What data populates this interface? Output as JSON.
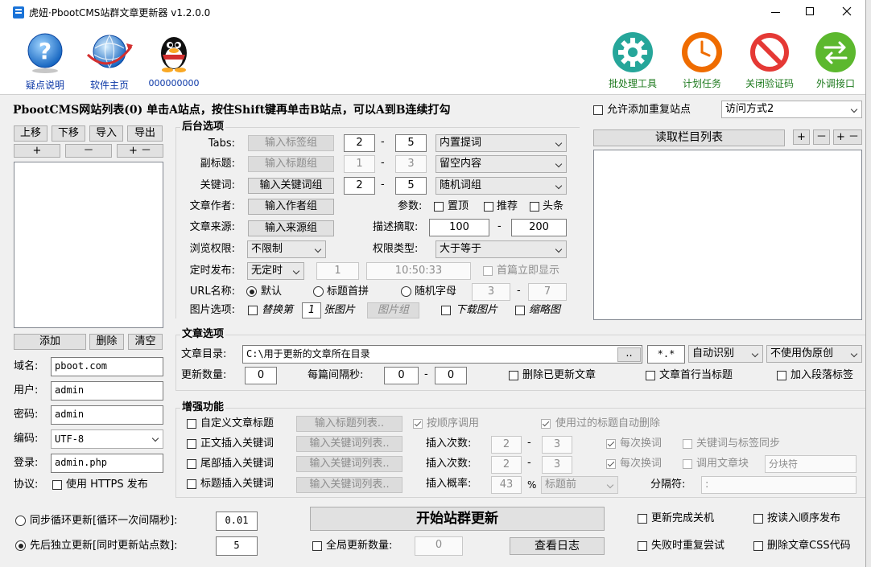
{
  "window": {
    "title": "虎妞·PbootCMS站群文章更新器 v1.2.0.0"
  },
  "toolbar": {
    "left": [
      {
        "label": "疑点说明",
        "icon": "help-icon"
      },
      {
        "label": "软件主页",
        "icon": "globe-icon"
      },
      {
        "label": "000000000",
        "icon": "qq-penguin-icon"
      }
    ],
    "right": [
      {
        "label": "批处理工具",
        "icon": "gear-icon"
      },
      {
        "label": "计划任务",
        "icon": "clock-icon"
      },
      {
        "label": "关闭验证码",
        "icon": "forbidden-icon"
      },
      {
        "label": "外调接口",
        "icon": "swap-arrows-icon"
      }
    ]
  },
  "sitelist": {
    "heading": "PbootCMS网站列表(0)  单击A站点，按住Shift键再单击B站点，可以A到B连续打勾",
    "allow_dup_label": "允许添加重复站点",
    "access_mode": "访问方式2",
    "btn_up": "上移",
    "btn_down": "下移",
    "btn_import": "导入",
    "btn_export": "导出",
    "btn_plus": "+",
    "btn_minus": "－",
    "btn_plusminus": "+ －",
    "btn_add": "添加",
    "btn_delete": "删除",
    "btn_clear": "清空"
  },
  "site_form": {
    "domain_label": "域名:",
    "domain": "pboot.com",
    "user_label": "用户:",
    "user": "admin",
    "pass_label": "密码:",
    "pass": "admin",
    "enc_label": "编码:",
    "enc": "UTF-8",
    "login_label": "登录:",
    "login": "admin.php",
    "proto_label": "协议:",
    "https_label": "使用 HTTPS 发布"
  },
  "backend": {
    "title": "后台选项",
    "tabs_label": "Tabs:",
    "tabs_btn": "输入标签组",
    "tabs_min": "2",
    "tabs_max": "5",
    "tabs_mode": "内置提词",
    "sub_label": "副标题:",
    "sub_btn": "输入标题组",
    "sub_min": "1",
    "sub_max": "3",
    "sub_mode": "留空内容",
    "kw_label": "关键词:",
    "kw_btn": "输入关键词组",
    "kw_min": "2",
    "kw_max": "5",
    "kw_mode": "随机词组",
    "author_label": "文章作者:",
    "author_btn": "输入作者组",
    "params_label": "参数:",
    "p_top": "置顶",
    "p_rec": "推荐",
    "p_head": "头条",
    "source_label": "文章来源:",
    "source_btn": "输入来源组",
    "desc_label": "描述摘取:",
    "desc_min": "100",
    "desc_max": "200",
    "perm_label": "浏览权限:",
    "perm": "不限制",
    "perm_type_label": "权限类型:",
    "perm_type": "大于等于",
    "timer_label": "定时发布:",
    "timer": "无定时",
    "timer_n": "1",
    "timer_time": "10:50:33",
    "first_now": "首篇立即显示",
    "url_label": "URL名称:",
    "url_default": "默认",
    "url_pinyin": "标题首拼",
    "url_random": "随机字母",
    "url_min": "3",
    "url_max": "7",
    "img_label": "图片选项:",
    "img_replace": "替换第",
    "img_n": "1",
    "img_unit": "张图片",
    "img_btn": "图片组",
    "img_download": "下载图片",
    "img_thumb": "缩略图"
  },
  "column": {
    "btn_read": "读取栏目列表",
    "btn_plus": "+",
    "btn_minus": "－",
    "btn_plusminus": "+ －"
  },
  "article": {
    "title": "文章选项",
    "dir_label": "文章目录:",
    "dir": "C:\\用于更新的文章所在目录",
    "browse": "..",
    "ext": "*.*",
    "enc_mode": "自动识别",
    "pseudo": "不使用伪原创",
    "count_label": "更新数量:",
    "count": "0",
    "interval_label": "每篇间隔秒:",
    "interval_min": "0",
    "interval_max": "0",
    "del_updated": "删除已更新文章",
    "first_line_title": "文章首行当标题",
    "add_tags": "加入段落标签"
  },
  "enhance": {
    "title": "增强功能",
    "r1_label": "自定义文章标题",
    "r1_btn": "输入标题列表..",
    "r1_order": "按顺序调用",
    "r1_autodel": "使用过的标题自动删除",
    "r2_label": "正文插入关键词",
    "r2_btn": "输入关键词列表..",
    "r2_times_label": "插入次数:",
    "r2_min": "2",
    "r2_max": "3",
    "r2_each": "每次换词",
    "r2_sync": "关键词与标签同步",
    "r3_label": "尾部插入关键词",
    "r3_btn": "输入关键词列表..",
    "r3_times_label": "插入次数:",
    "r3_min": "2",
    "r3_max": "3",
    "r3_each": "每次换词",
    "r3_block": "调用文章块",
    "r3_block_ph": "分块符",
    "r4_label": "标题插入关键词",
    "r4_btn": "输入关键词列表..",
    "r4_prob_label": "插入概率:",
    "r4_prob": "43",
    "r4_pct": "%",
    "r4_pos": "标题前",
    "r4_sep_label": "分隔符:",
    "r4_sep": ":"
  },
  "bottom": {
    "sync_loop": "同步循环更新[循环一次间隔秒]:",
    "sync_val": "0.01",
    "seq_update": "先后独立更新[同时更新站点数]:",
    "seq_val": "5",
    "start": "开始站群更新",
    "global_count": "全局更新数量:",
    "global_val": "0",
    "log": "查看日志",
    "shutdown": "更新完成关机",
    "read_order": "按读入顺序发布",
    "retry": "失败时重复尝试",
    "del_css": "删除文章CSS代码"
  }
}
